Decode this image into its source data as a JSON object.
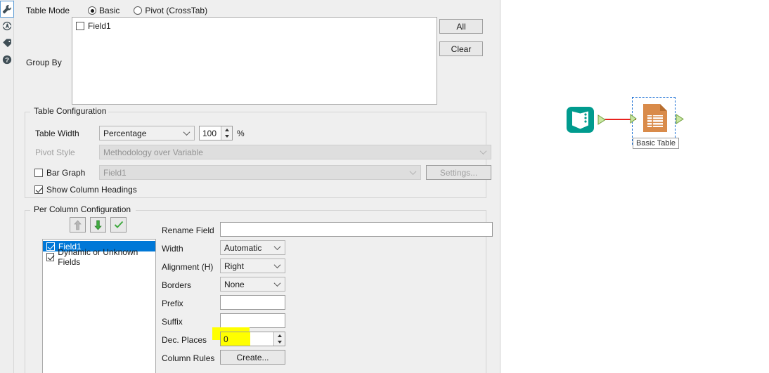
{
  "icon_rail": {
    "items": [
      {
        "name": "wrench-icon",
        "title": "Configuration",
        "active": true
      },
      {
        "name": "annotation-icon",
        "title": "Annotation",
        "active": false
      },
      {
        "name": "tag-icon",
        "title": "Label",
        "active": false
      },
      {
        "name": "help-icon",
        "title": "Help",
        "active": false
      }
    ]
  },
  "table_mode": {
    "label": "Table Mode",
    "options": [
      {
        "label": "Basic",
        "checked": true
      },
      {
        "label": "Pivot (CrossTab)",
        "checked": false
      }
    ]
  },
  "group_by": {
    "label": "Group By",
    "fields": [
      {
        "label": "Field1",
        "checked": false
      }
    ],
    "all_button": "All",
    "clear_button": "Clear"
  },
  "table_configuration": {
    "title": "Table Configuration",
    "table_width": {
      "label": "Table Width",
      "value": "Percentage",
      "amount": "100",
      "unit": "%"
    },
    "pivot_style": {
      "label": "Pivot Style",
      "value": "Methodology over Variable",
      "disabled": true
    },
    "bar_graph": {
      "label": "Bar Graph",
      "checked": false,
      "field_value": "Field1",
      "settings_button": "Settings...",
      "disabled": true
    },
    "show_column_headings": {
      "label": "Show Column Headings",
      "checked": true
    }
  },
  "per_column_configuration": {
    "title": "Per Column Configuration",
    "toolbar": [
      {
        "name": "move-up-button",
        "glyph": "up-arrow-icon",
        "disabled": true
      },
      {
        "name": "move-down-button",
        "glyph": "down-arrow-icon",
        "disabled": false
      },
      {
        "name": "select-all-button",
        "glyph": "check-icon",
        "disabled": false
      }
    ],
    "fields": [
      {
        "label": "Field1",
        "checked": true,
        "selected": true
      },
      {
        "label": "Dynamic or Unknown Fields",
        "checked": true,
        "selected": false
      }
    ],
    "rename_field": {
      "label": "Rename Field",
      "value": ""
    },
    "width": {
      "label": "Width",
      "value": "Automatic"
    },
    "alignment": {
      "label": "Alignment (H)",
      "value": "Right"
    },
    "borders": {
      "label": "Borders",
      "value": "None"
    },
    "prefix": {
      "label": "Prefix",
      "value": ""
    },
    "suffix": {
      "label": "Suffix",
      "value": ""
    },
    "dec_places": {
      "label": "Dec. Places",
      "value": "0",
      "highlighted": true
    },
    "column_rules": {
      "label": "Column Rules",
      "button": "Create..."
    }
  },
  "canvas": {
    "nodes": [
      {
        "name": "text-input-tool",
        "icon": "book-icon",
        "color": "#009b8e",
        "label": ""
      },
      {
        "name": "basic-table-tool",
        "icon": "table-document-icon",
        "color": "#d98b4a",
        "label": "Basic Table",
        "selected": true
      }
    ],
    "connection_color": "#e8221e"
  },
  "colors": {
    "selection_blue": "#0078d7",
    "highlight_yellow": "#ffff00",
    "teal": "#009b8e",
    "orange": "#d98b4a"
  }
}
